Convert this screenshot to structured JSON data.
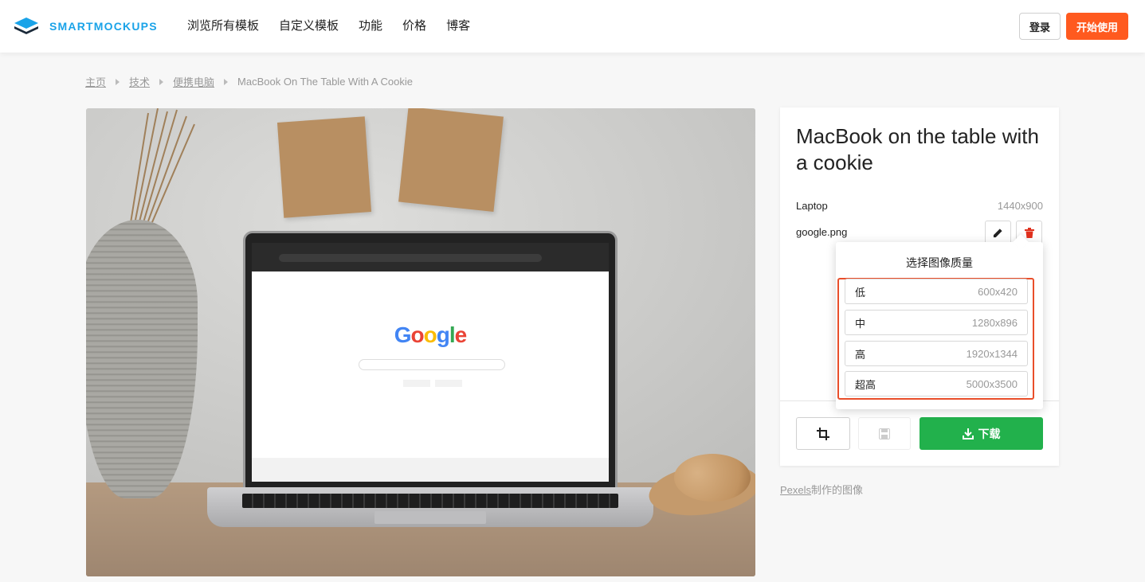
{
  "header": {
    "brand": "SMARTMOCKUPS",
    "nav": [
      "浏览所有模板",
      "自定义模板",
      "功能",
      "价格",
      "博客"
    ],
    "login_label": "登录",
    "start_label": "开始使用",
    "accent_color": "#ff5a1f",
    "brand_color": "#1aa3e8"
  },
  "breadcrumb": {
    "items": [
      "主页",
      "技术",
      "便携电脑"
    ],
    "current": "MacBook On The Table With A Cookie"
  },
  "panel": {
    "title": "MacBook on the table with a cookie",
    "device_label": "Laptop",
    "resolution": "1440x900",
    "file_name": "google.png",
    "edit_icon": "pencil-icon",
    "delete_icon": "trash-icon",
    "crop_icon": "crop-icon",
    "save_icon": "save-icon",
    "download_label": "下载",
    "download_color": "#22b14c"
  },
  "quality_menu": {
    "title": "选择图像质量",
    "options": [
      {
        "label": "低",
        "size": "600x420"
      },
      {
        "label": "中",
        "size": "1280x896"
      },
      {
        "label": "高",
        "size": "1920x1344"
      },
      {
        "label": "超高",
        "size": "5000x3500"
      }
    ],
    "highlight_color": "#e94e2a"
  },
  "credit": {
    "link": "Pexels",
    "suffix": "制作的图像"
  }
}
